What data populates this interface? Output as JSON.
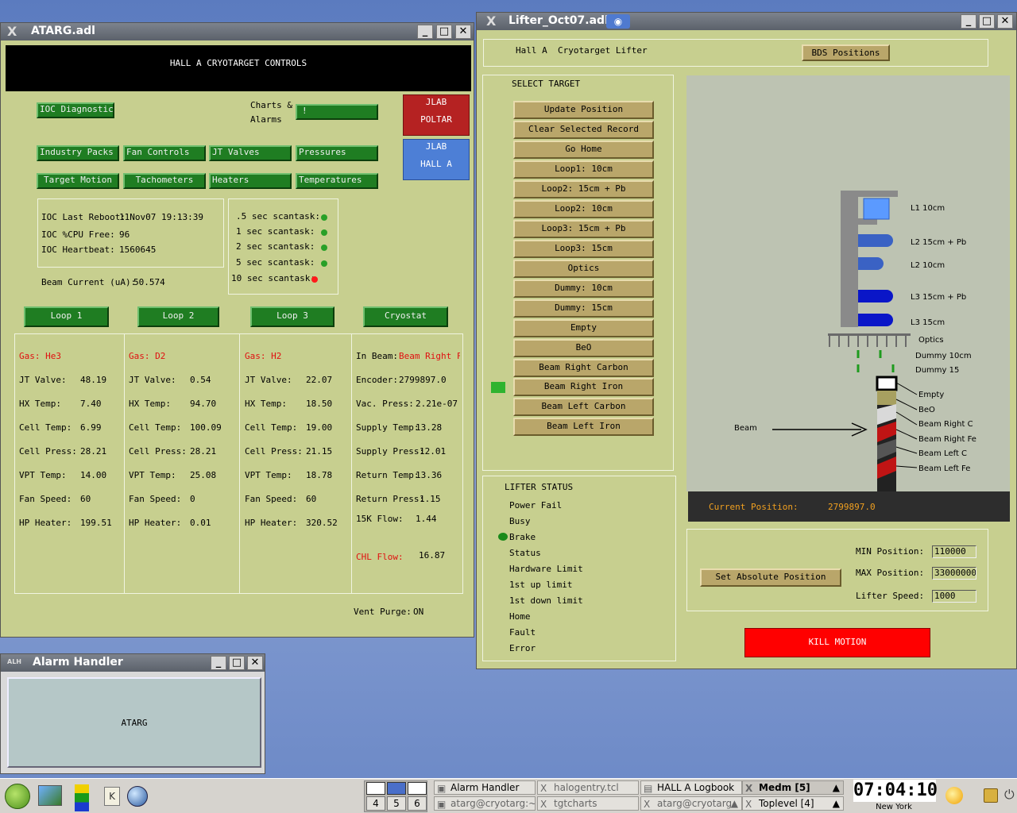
{
  "atarg_window": {
    "title": "ATARG.adl",
    "header": "HALL A CRYOTARGET CONTROLS",
    "ioc_diagnostics": "IOC Diagnostics",
    "charts_label_1": "Charts &",
    "charts_label_2": "Alarms",
    "charts_button": "!",
    "jlab_poltar_1": "JLAB",
    "jlab_poltar_2": "POLTAR",
    "jlab_halla_1": "JLAB",
    "jlab_halla_2": "HALL A",
    "row1": [
      "Industry Packs",
      "Fan Controls",
      "JT Valves",
      "Pressures"
    ],
    "row2": [
      "Target Motion",
      "Tachometers",
      "Heaters",
      "Temperatures"
    ],
    "ioc": {
      "reboot_label": "IOC Last Reboot:",
      "reboot_value": "11Nov07 19:13:39",
      "cpu_label": "IOC %CPU Free:",
      "cpu_value": "96",
      "heartbeat_label": "IOC Heartbeat:",
      "heartbeat_value": "1560645"
    },
    "scantasks": [
      ".5 sec scantask:",
      "1 sec scantask:",
      "2 sec scantask:",
      "5 sec scantask:",
      "10 sec scantask:"
    ],
    "beam_current_label": "Beam Current (uA):",
    "beam_current_value": "50.574",
    "loop_buttons": [
      "Loop 1",
      "Loop 2",
      "Loop 3",
      "Cryostat"
    ],
    "loop_labels": [
      "JT Valve:",
      "HX Temp:",
      "Cell Temp:",
      "Cell Press:",
      "VPT Temp:",
      "Fan Speed:",
      "HP Heater:"
    ],
    "loops": [
      {
        "gas": "Gas: He3",
        "values": [
          "48.19",
          "7.40",
          "6.99",
          "28.21",
          "14.00",
          "60",
          "199.51"
        ]
      },
      {
        "gas": "Gas: D2",
        "values": [
          "0.54",
          "94.70",
          "100.09",
          "28.21",
          "25.08",
          "0",
          "0.01"
        ]
      },
      {
        "gas": "Gas: H2",
        "values": [
          "22.07",
          "18.50",
          "19.00",
          "21.15",
          "18.78",
          "60",
          "320.52"
        ]
      }
    ],
    "cryostat": {
      "in_beam_label": "In Beam:",
      "in_beam_value": "Beam Right Fe",
      "labels": [
        "Encoder:",
        "Vac. Press:",
        "Supply Temp:",
        "Supply Press:",
        "Return Temp:",
        "Return Press:",
        "15K Flow:"
      ],
      "values": [
        "2799897.0",
        "2.21e-07",
        "13.28",
        "12.01",
        "13.36",
        "1.15",
        "1.44"
      ],
      "chl_label": "CHL Flow:",
      "chl_value": "16.87"
    },
    "vent_purge_label": "Vent Purge:",
    "vent_purge_value": "ON"
  },
  "alarm_window": {
    "title": "Alarm Handler",
    "group": "ATARG"
  },
  "lifter_window": {
    "title": "Lifter_Oct07.adl",
    "hall": "Hall A",
    "subtitle": "Cryotarget Lifter",
    "bds_button": "BDS Positions",
    "select_target": "SELECT TARGET",
    "targets": [
      "Update Position",
      "Clear Selected Record",
      "Go Home",
      "Loop1: 10cm",
      "Loop2: 15cm + Pb",
      "Loop2: 10cm",
      "Loop3: 15cm + Pb",
      "Loop3: 15cm",
      "Optics",
      "Dummy: 10cm",
      "Dummy: 15cm",
      "Empty",
      "BeO",
      "Beam Right Carbon",
      "Beam Right Iron",
      "Beam Left Carbon",
      "Beam Left Iron"
    ],
    "diagram_labels": [
      "L1 10cm",
      "L2 15cm + Pb",
      "L2 10cm",
      "L3 15cm + Pb",
      "L3 15cm",
      "Optics",
      "Dummy 10cm",
      "Dummy 15",
      "Empty",
      "BeO",
      "Beam Right C",
      "Beam Right Fe",
      "Beam Left C",
      "Beam Left Fe"
    ],
    "beam_label": "Beam",
    "current_position_label": "Current Position:",
    "current_position_value": "2799897.0",
    "lifter_status_title": "LIFTER STATUS",
    "status_items": [
      "Power Fail",
      "Busy",
      "Brake",
      "Status",
      "Hardware Limit",
      "1st up limit",
      "1st down limit",
      "Home",
      "Fault",
      "Error"
    ],
    "set_absolute": "Set Absolute Position",
    "min_label": "MIN Position:",
    "min_value": "110000",
    "max_label": "MAX Position:",
    "max_value": "33000000",
    "speed_label": "Lifter Speed:",
    "speed_value": "1000",
    "kill_motion": "KILL MOTION"
  },
  "taskbar": {
    "workspaces": [
      "4",
      "5",
      "6"
    ],
    "tasks_top": [
      "Alarm Handler",
      "halogentry.tcl",
      "HALL A Logbook",
      "Medm [5]"
    ],
    "tasks_bottom": [
      "atarg@cryotarg:~",
      "tgtcharts",
      "atarg@cryotarg",
      "Toplevel [4]"
    ],
    "clock": "07:04:10",
    "clock_city": "New York"
  },
  "colors": {
    "panel": "#c7cf8f",
    "green_button": "#1f7d22",
    "tan_button": "#b9a66a",
    "alarm_red": "#ff0000"
  }
}
